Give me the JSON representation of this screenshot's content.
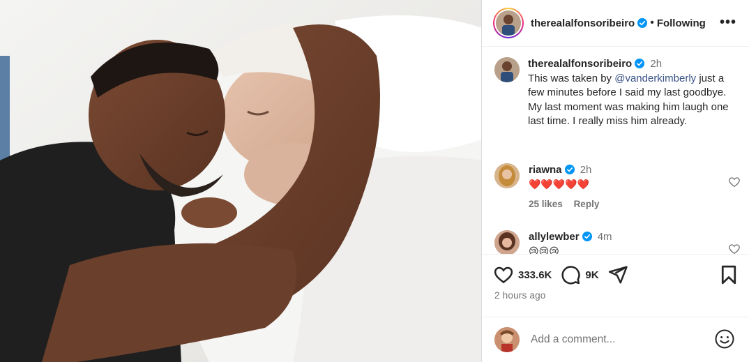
{
  "header": {
    "username": "therealalfonsoribeiro",
    "separator": "•",
    "follow_label": "Following",
    "more_label": "•••"
  },
  "caption": {
    "username": "therealalfonsoribeiro",
    "time": "2h",
    "text_before": "This was taken by ",
    "mention": "@vanderkimberly",
    "text_after": " just a few minutes before I said my last goodbye. My last moment was making him laugh one last time. I really miss him already."
  },
  "comments": [
    {
      "username": "riawna",
      "time": "2h",
      "text": "❤️❤️❤️❤️❤️",
      "likes": "25 likes",
      "reply_label": "Reply"
    },
    {
      "username": "allylewber",
      "time": "4m",
      "text": "😢😢😢"
    }
  ],
  "actions": {
    "likes_count": "333.6K",
    "comments_count": "9K",
    "posted_ago": "2 hours ago"
  },
  "add_comment": {
    "placeholder": "Add a comment..."
  },
  "colors": {
    "link": "#385185",
    "verified": "#0095f6",
    "muted": "#737373",
    "heart": "#ed4956"
  },
  "icons": [
    "verified-icon",
    "more-options-icon",
    "heart-icon",
    "comment-icon",
    "share-icon",
    "bookmark-icon",
    "like-comment-icon",
    "emoji-icon"
  ]
}
